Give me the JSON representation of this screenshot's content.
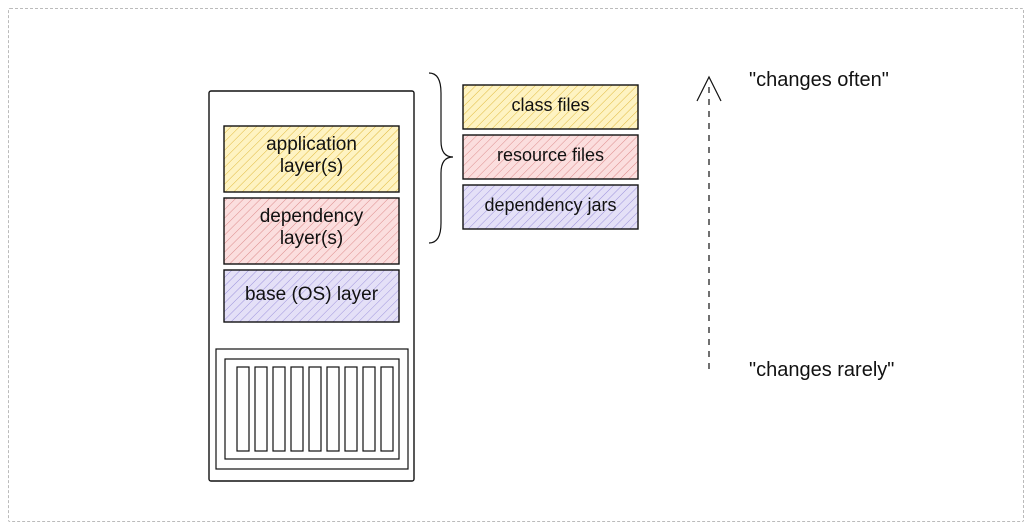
{
  "stack": {
    "application_label": "application\nlayer(s)",
    "dependency_label": "dependency\nlayer(s)",
    "base_label": "base (OS) layer"
  },
  "detail": {
    "top_label": "class files",
    "middle_label": "resource files",
    "bottom_label": "dependency jars"
  },
  "annotations": {
    "top_label": "\"changes often\"",
    "bottom_label": "\"changes rarely\""
  },
  "colors": {
    "yellow_stroke": "#d4a514",
    "pink_stroke": "#c96a6a",
    "purple_stroke": "#7e74c2"
  }
}
